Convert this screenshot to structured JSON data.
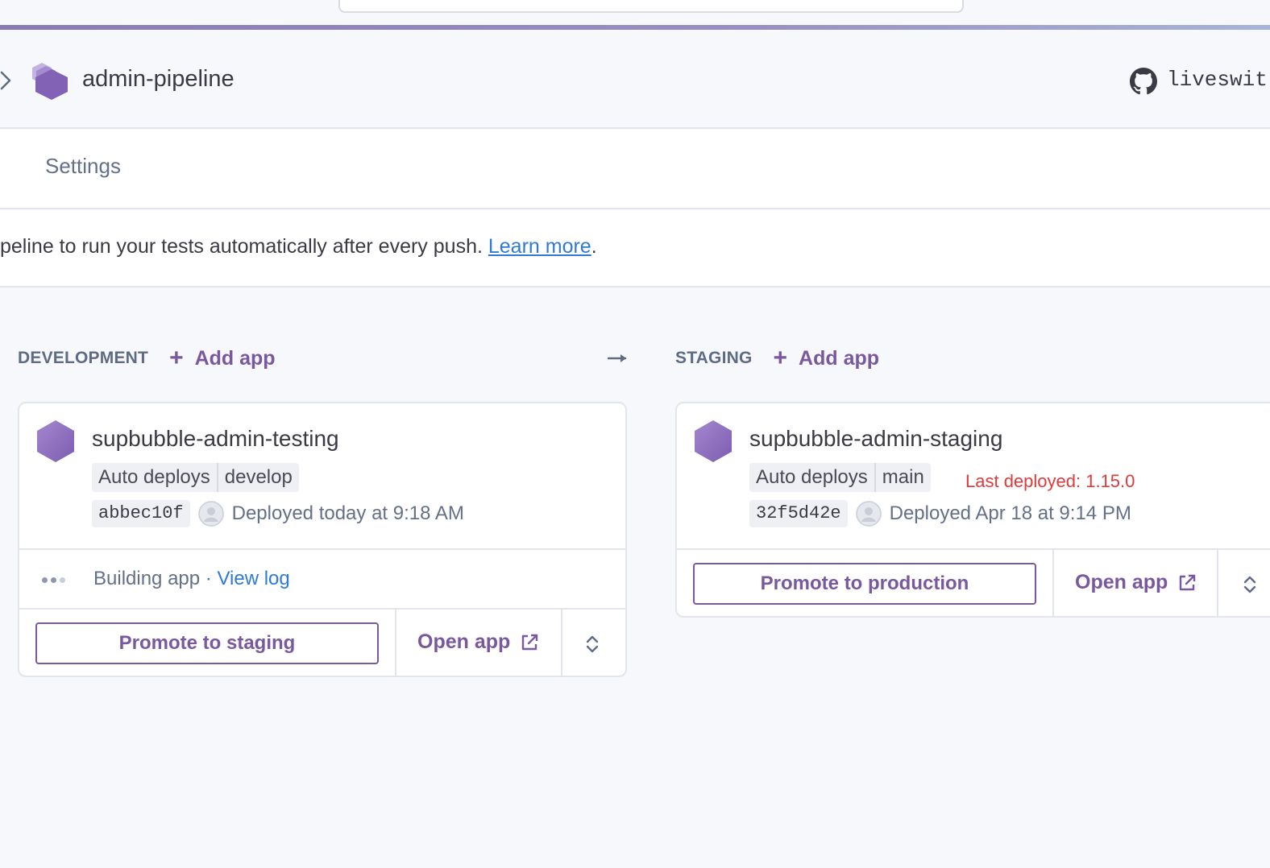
{
  "header": {
    "pipeline_name": "admin-pipeline",
    "repo": "liveswit"
  },
  "tabs": {
    "settings": "Settings"
  },
  "notice": {
    "text": "peline to run your tests automatically after every push. ",
    "link": "Learn more",
    "suffix": "."
  },
  "stages": {
    "development": {
      "label": "DEVELOPMENT",
      "add_app": "Add app",
      "app": {
        "name": "supbubble-admin-testing",
        "auto_deploys": "Auto deploys",
        "branch": "develop",
        "commit": "abbec10f",
        "deployed": "Deployed today at 9:18 AM",
        "build_status": "Building app",
        "separator": " · ",
        "view_log": "View log",
        "promote": "Promote to staging",
        "open_app": "Open app"
      }
    },
    "staging": {
      "label": "STAGING",
      "add_app": "Add app",
      "app": {
        "name": "supbubble-admin-staging",
        "auto_deploys": "Auto deploys",
        "branch": "main",
        "last_deployed": "Last deployed: 1.15.0",
        "commit": "32f5d42e",
        "deployed": "Deployed Apr 18 at 9:14 PM",
        "promote": "Promote to production",
        "open_app": "Open app"
      }
    }
  },
  "icons": {
    "pipeline": "pipeline-stack-icon",
    "github": "github-icon",
    "app": "hexagon-app-icon",
    "external": "external-link-icon",
    "expand": "chevron-up-down-icon",
    "avatar": "user-avatar-icon",
    "arrow": "arrow-right-icon"
  },
  "colors": {
    "accent": "#79589f",
    "link": "#2f79d9",
    "warning": "#e03a3a"
  }
}
